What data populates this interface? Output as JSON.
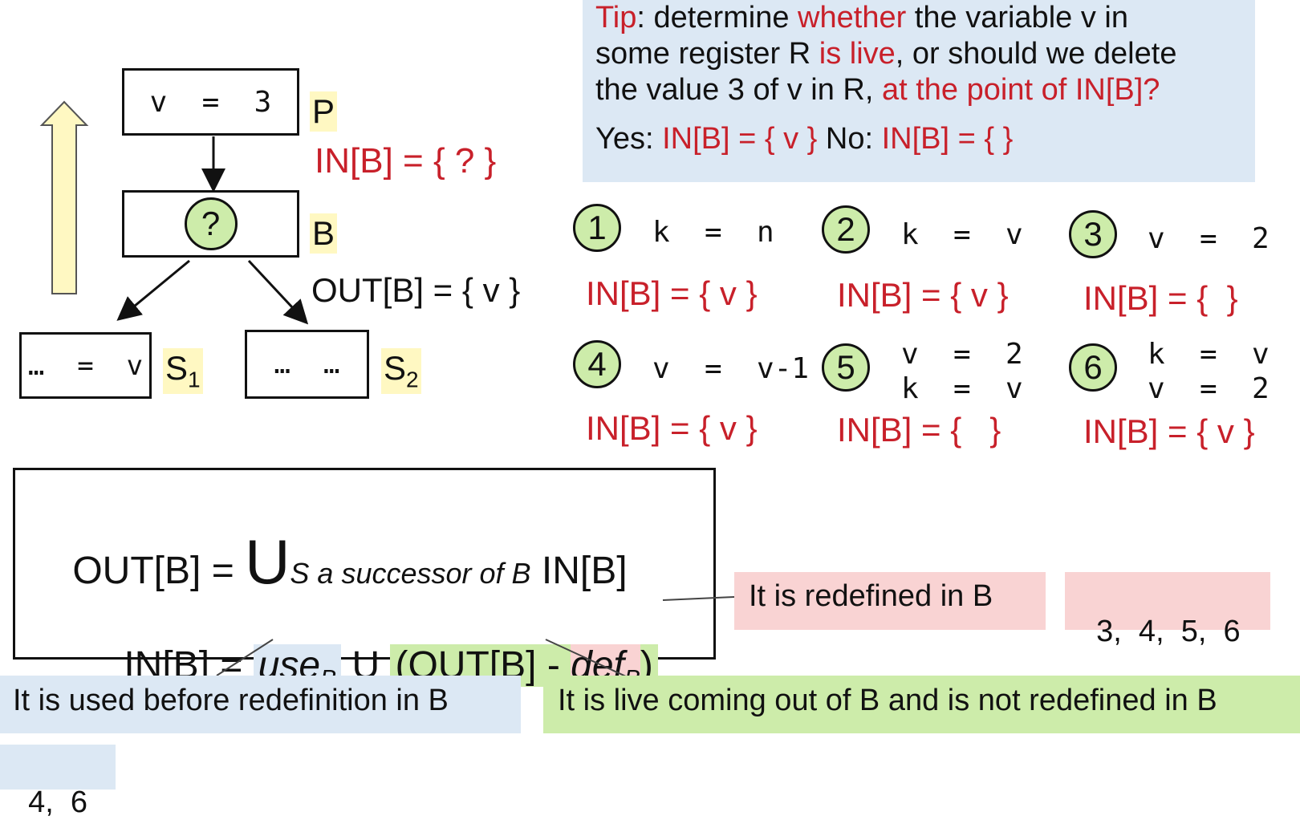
{
  "tip": {
    "line1_a": "Tip",
    "line1_b": ": determine ",
    "line1_c": "whether",
    "line1_d": " the variable v in",
    "line2_a": "some register R ",
    "line2_b": "is live",
    "line2_c": ", or should we delete",
    "line3_a": "the value 3 of v in R, ",
    "line3_b": "at the point of IN[B]?",
    "yes_label": "Yes: ",
    "yes_value": "IN[B] = { v }",
    "no_label": " No: ",
    "no_value": "IN[B] = { }"
  },
  "cfg": {
    "p_block": "v  =  3",
    "p_label": "P",
    "inb_query": "IN[B] = { ? }",
    "b_block_symbol": "?",
    "b_label": "B",
    "outb": "OUT[B] = { v }",
    "s1_block": "…  =  v",
    "s1_label": "S",
    "s1_sub": "1",
    "s2_block": "…  …",
    "s2_label": "S",
    "s2_sub": "2"
  },
  "cases": [
    {
      "num": "1",
      "code1": "k  =  n",
      "code2": "",
      "result": "IN[B] = { v }"
    },
    {
      "num": "2",
      "code1": "k  =  v",
      "code2": "",
      "result": "IN[B] = { v }"
    },
    {
      "num": "3",
      "code1": "v  =  2",
      "code2": "",
      "result": "IN[B] = {  }"
    },
    {
      "num": "4",
      "code1": "v  =  v-1",
      "code2": "",
      "result": "IN[B] = { v }"
    },
    {
      "num": "5",
      "code1": "v  =  2",
      "code2": "k  =  v",
      "result": "IN[B] = {   }"
    },
    {
      "num": "6",
      "code1": "k  =  v",
      "code2": "v  =  2",
      "result": "IN[B] = { v }"
    }
  ],
  "formula": {
    "out_lhs": "OUT[B] = ",
    "union": "U",
    "out_sub": "S a successor of B",
    "out_rhs": " IN[B]",
    "in_lhs": "IN[B] = ",
    "use": "use",
    "use_sub": "B",
    "union2": " U ",
    "out_part": "(OUT[B] - ",
    "def": "def",
    "def_sub": "B",
    "close": ")"
  },
  "notes": {
    "redefined": "It is redefined in B",
    "redefined_cases": "3,  4,  5,  6",
    "used_before": "It is used before redefinition in B",
    "used_cases": "4,  6",
    "live_out": "It is live coming out of B and is not redefined in B"
  },
  "colors": {
    "red": "#c8202a",
    "tip_bg": "#dce8f4",
    "green_bg": "#cdecaa",
    "pink_bg": "#f9d3d3",
    "yellow_bg": "#fff8c2"
  }
}
